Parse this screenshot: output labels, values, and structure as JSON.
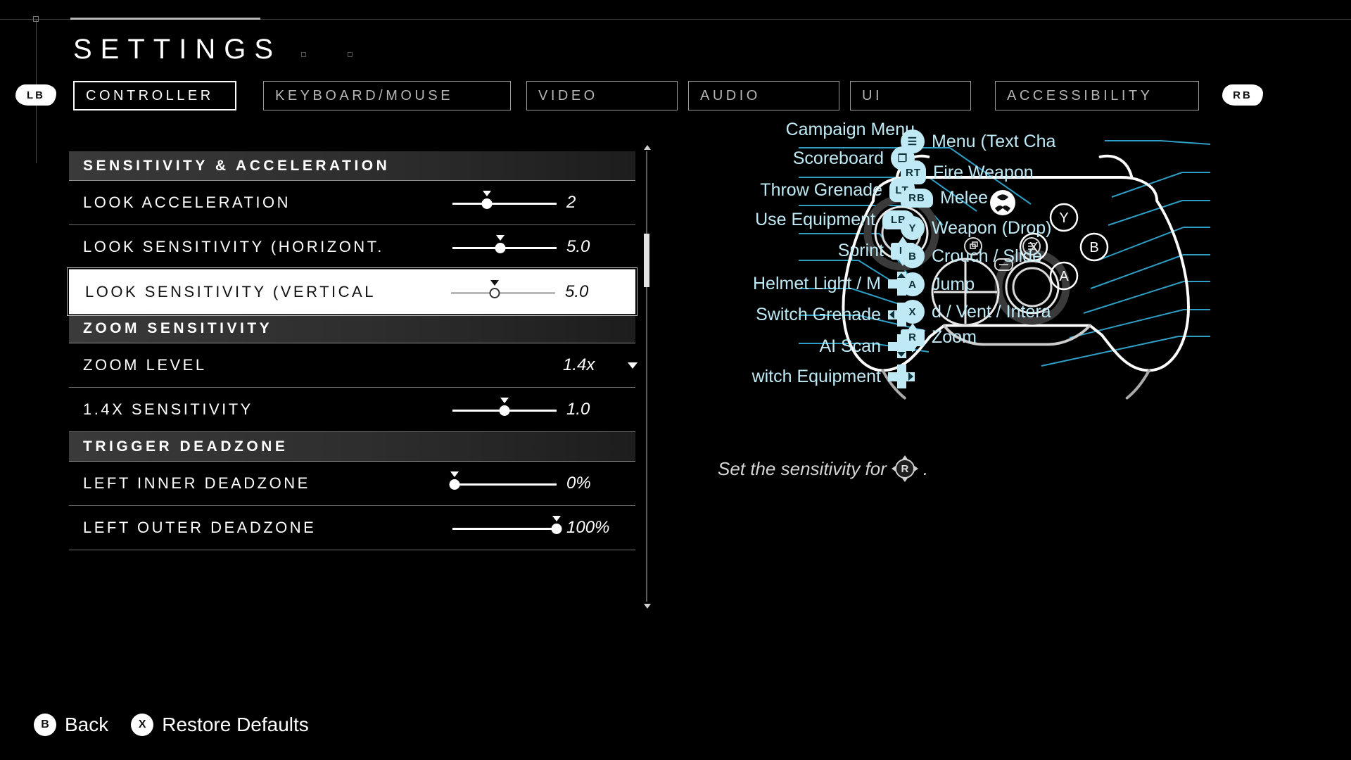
{
  "header": {
    "title": "SETTINGS",
    "bumper_left": "LB",
    "bumper_right": "RB"
  },
  "tabs": [
    {
      "label": "CONTROLLER",
      "active": true
    },
    {
      "label": "KEYBOARD/MOUSE",
      "active": false
    },
    {
      "label": "VIDEO",
      "active": false
    },
    {
      "label": "AUDIO",
      "active": false
    },
    {
      "label": "UI",
      "active": false
    },
    {
      "label": "ACCESSIBILITY",
      "active": false
    }
  ],
  "settings": {
    "groups": [
      {
        "header": "SENSITIVITY & ACCELERATION",
        "rows": [
          {
            "label": "LOOK ACCELERATION",
            "value": "2",
            "type": "slider",
            "fill": 0.33,
            "selected": false
          },
          {
            "label": "LOOK SENSITIVITY (HORIZONT.",
            "value": "5.0",
            "type": "slider",
            "fill": 0.46,
            "selected": false
          },
          {
            "label": "LOOK SENSITIVITY (VERTICAL",
            "value": "5.0",
            "type": "slider",
            "fill": 0.42,
            "selected": true
          }
        ]
      },
      {
        "header": "ZOOM SENSITIVITY",
        "rows": [
          {
            "label": "ZOOM LEVEL",
            "value": "1.4x",
            "type": "dropdown",
            "fill": 0,
            "selected": false
          },
          {
            "label": "1.4X SENSITIVITY",
            "value": "1.0",
            "type": "slider",
            "fill": 0.5,
            "selected": false
          }
        ]
      },
      {
        "header": "TRIGGER DEADZONE",
        "rows": [
          {
            "label": "LEFT INNER DEADZONE",
            "value": "0%",
            "type": "slider",
            "fill": 0.02,
            "selected": false
          },
          {
            "label": "LEFT OUTER DEADZONE",
            "value": "100%",
            "type": "slider",
            "fill": 1.0,
            "selected": false
          }
        ]
      }
    ]
  },
  "controller": {
    "left_bindings": [
      {
        "label": "Campaign Menu",
        "glyph": "",
        "glyph_type": "none"
      },
      {
        "label": "Scoreboard",
        "glyph": "❐",
        "glyph_type": "circle"
      },
      {
        "label": "Throw Grenade",
        "glyph": "LT",
        "glyph_type": "trig"
      },
      {
        "label": "Use Equipment",
        "glyph": "LB",
        "glyph_type": "bump"
      },
      {
        "label": "Sprint",
        "glyph": "L",
        "glyph_type": "stick"
      },
      {
        "label": "Helmet Light / M",
        "glyph": "dpad-up",
        "glyph_type": "dpad-up"
      },
      {
        "label": "Switch Grenade",
        "glyph": "dpad-left",
        "glyph_type": "dpad-left"
      },
      {
        "label": "AI Scan",
        "glyph": "dpad-down",
        "glyph_type": "dpad-down"
      },
      {
        "label": "witch Equipment",
        "glyph": "dpad-right",
        "glyph_type": "dpad-right"
      }
    ],
    "right_bindings": [
      {
        "label": "Menu (Text Cha",
        "glyph": "☰",
        "glyph_type": "circle"
      },
      {
        "label": "Fire Weapon",
        "glyph": "RT",
        "glyph_type": "trig"
      },
      {
        "label": "Melee",
        "glyph": "RB",
        "glyph_type": "bump"
      },
      {
        "label": "Weapon (Drop)",
        "glyph": "Y",
        "glyph_type": "circle"
      },
      {
        "label": "Crouch / Slide",
        "glyph": "B",
        "glyph_type": "circle"
      },
      {
        "label": "Jump",
        "glyph": "A",
        "glyph_type": "circle"
      },
      {
        "label": "d / Vent / Intera",
        "glyph": "X",
        "glyph_type": "circle"
      },
      {
        "label": "Zoom",
        "glyph": "R",
        "glyph_type": "stick"
      }
    ],
    "hint_prefix": "Set the sensitivity for",
    "hint_glyph": "R",
    "hint_suffix": "."
  },
  "footer": [
    {
      "button": "B",
      "label": "Back"
    },
    {
      "button": "X",
      "label": "Restore Defaults"
    }
  ],
  "colors": {
    "accent_cyan": "#bfeaf5",
    "background": "#000000",
    "selected_bg": "#ffffff"
  }
}
